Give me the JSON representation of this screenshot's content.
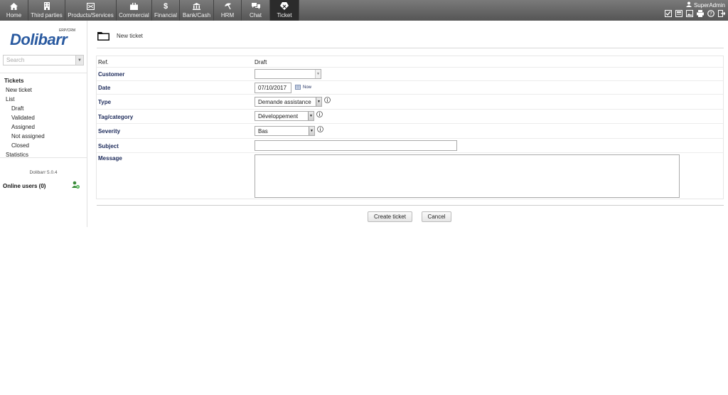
{
  "topmenu": [
    {
      "label": "Home",
      "icon": "home-icon"
    },
    {
      "label": "Third parties",
      "icon": "building-icon"
    },
    {
      "label": "Products/Services",
      "icon": "box-icon"
    },
    {
      "label": "Commercial",
      "icon": "briefcase-icon"
    },
    {
      "label": "Financial",
      "icon": "dollar-icon"
    },
    {
      "label": "Bank/Cash",
      "icon": "bank-icon"
    },
    {
      "label": "HRM",
      "icon": "umbrella-icon"
    },
    {
      "label": "Chat",
      "icon": "chat-icon"
    },
    {
      "label": "Ticket",
      "icon": "ticket-icon"
    }
  ],
  "user": {
    "name": "SuperAdmin"
  },
  "logo": {
    "name": "Dolibarr",
    "tag": "ERP/CRM"
  },
  "search": {
    "placeholder": "Search"
  },
  "leftmenu": {
    "heading": "Tickets",
    "items": [
      {
        "label": "New ticket",
        "level": 1
      },
      {
        "label": "List",
        "level": 1
      },
      {
        "label": "Draft",
        "level": 2
      },
      {
        "label": "Validated",
        "level": 2
      },
      {
        "label": "Assigned",
        "level": 2
      },
      {
        "label": "Not assigned",
        "level": 2
      },
      {
        "label": "Closed",
        "level": 2
      },
      {
        "label": "Statistics",
        "level": 1
      }
    ]
  },
  "version": "Dolibarr 5.0.4",
  "online_users": "Online users (0)",
  "page": {
    "title": "New ticket"
  },
  "form": {
    "ref_label": "Ref.",
    "ref_value": "Draft",
    "customer_label": "Customer",
    "customer_value": "",
    "date_label": "Date",
    "date_value": "07/10/2017",
    "now_label": "Now",
    "type_label": "Type",
    "type_value": "Demande assistance",
    "tag_label": "Tag/category",
    "tag_value": "Développement",
    "severity_label": "Severity",
    "severity_value": "Bas",
    "subject_label": "Subject",
    "subject_value": "",
    "message_label": "Message",
    "message_value": ""
  },
  "buttons": {
    "create": "Create ticket",
    "cancel": "Cancel"
  },
  "colors": {
    "topbar": "#5f5f5f",
    "active_tab": "#2b2b2b",
    "label_blue": "#1c2a5a",
    "logo_blue": "#2a5aa0"
  }
}
